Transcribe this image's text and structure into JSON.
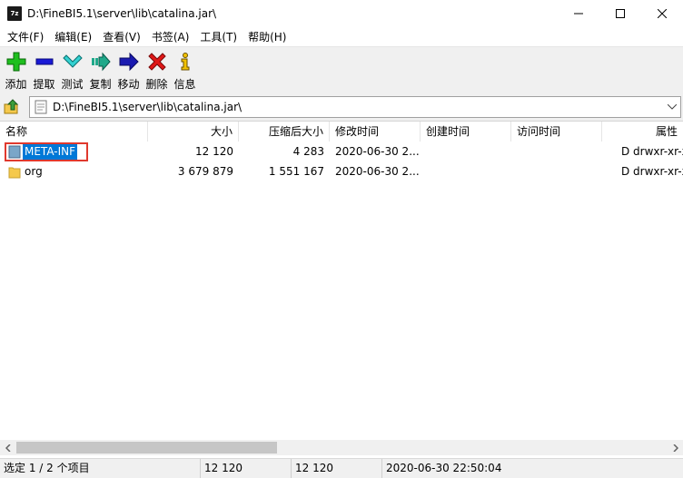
{
  "window": {
    "app_icon_text": "7z",
    "title": "D:\\FineBI5.1\\server\\lib\\catalina.jar\\"
  },
  "menu": [
    "文件(F)",
    "编辑(E)",
    "查看(V)",
    "书签(A)",
    "工具(T)",
    "帮助(H)"
  ],
  "toolbar": {
    "add": "添加",
    "extract": "提取",
    "test": "测试",
    "copy": "复制",
    "move": "移动",
    "delete": "删除",
    "info": "信息"
  },
  "address": {
    "path": "D:\\FineBI5.1\\server\\lib\\catalina.jar\\"
  },
  "columns": {
    "name": "名称",
    "size": "大小",
    "packed": "压缩后大小",
    "modified": "修改时间",
    "created": "创建时间",
    "accessed": "访问时间",
    "attributes": "属性"
  },
  "rows": [
    {
      "name": "META-INF",
      "size": "12 120",
      "packed": "4 283",
      "modified": "2020-06-30 2...",
      "attributes": "D drwxr-xr-x",
      "selected": true
    },
    {
      "name": "org",
      "size": "3 679 879",
      "packed": "1 551 167",
      "modified": "2020-06-30 2...",
      "attributes": "D drwxr-xr-x",
      "selected": false
    }
  ],
  "status": {
    "selection": "选定 1 / 2 个项目",
    "size": "12 120",
    "packed": "12 120",
    "modified": "2020-06-30 22:50:04"
  },
  "colors": {
    "selection": "#0078d7",
    "highlight_border": "#e0392e",
    "folder": "#f5c94c"
  }
}
